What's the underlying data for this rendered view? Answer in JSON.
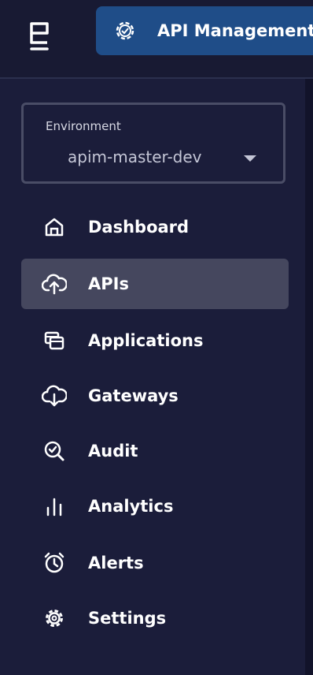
{
  "header": {
    "product_title": "API Management"
  },
  "environment": {
    "label": "Environment",
    "value": "apim-master-dev"
  },
  "nav": {
    "items": [
      {
        "label": "Dashboard",
        "icon": "home-icon",
        "active": false
      },
      {
        "label": "APIs",
        "icon": "cloud-upload-icon",
        "active": true
      },
      {
        "label": "Applications",
        "icon": "windows-icon",
        "active": false
      },
      {
        "label": "Gateways",
        "icon": "cloud-download-icon",
        "active": false
      },
      {
        "label": "Audit",
        "icon": "search-check-icon",
        "active": false
      },
      {
        "label": "Analytics",
        "icon": "bar-chart-icon",
        "active": false
      },
      {
        "label": "Alerts",
        "icon": "alarm-clock-icon",
        "active": false
      },
      {
        "label": "Settings",
        "icon": "gear-icon",
        "active": false
      }
    ]
  },
  "colors": {
    "background": "#181a33",
    "sidebar": "#1b1d3a",
    "product_tab": "#1f4d88",
    "active_item": "#45475e",
    "border": "#4a4d66"
  }
}
